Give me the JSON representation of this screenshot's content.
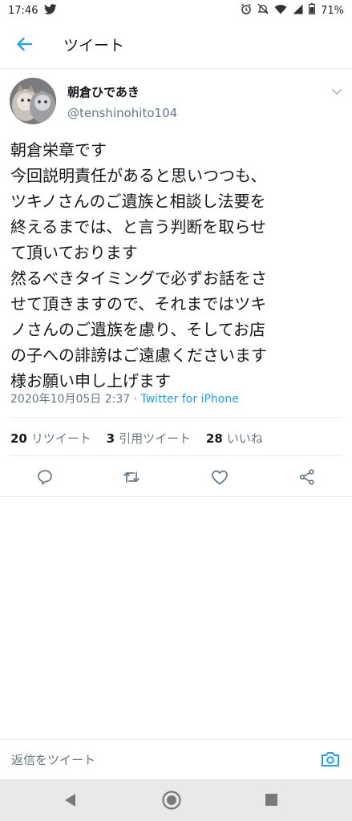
{
  "status_bar": {
    "time": "17:46",
    "battery": "71%",
    "icons": [
      "twitter-icon",
      "alarm-icon",
      "mute-icon",
      "wifi-icon",
      "signal-icon",
      "battery-icon"
    ]
  },
  "header": {
    "title": "ツイート",
    "back_icon": "back-arrow-icon"
  },
  "tweet": {
    "display_name": "朝倉ひであき",
    "handle": "@tenshinohito104",
    "lines": [
      "朝倉栄章です",
      "今回説明責任があると思いつつも、",
      "ツキノさんのご遺族と相談し法要を",
      "終えるまでは、と言う判断を取らせ",
      "て頂いております",
      "然るべきタイミングで必ずお話をさ",
      "せて頂きますので、それまではツキ",
      "ノさんのご遺族を慮り、そしてお店",
      "の子への誹謗はご遠慮くださいます",
      "様お願い申し上げます"
    ],
    "timestamp": "2020年10月05日 2:37 · ",
    "source": "Twitter for iPhone"
  },
  "stats": {
    "retweets_count": "20",
    "retweets_label": "リツイート",
    "quotes_count": "3",
    "quotes_label": "引用ツイート",
    "likes_count": "28",
    "likes_label": "いいね"
  },
  "actions": [
    "reply-icon",
    "retweet-icon",
    "like-icon",
    "share-icon"
  ],
  "reply_bar": {
    "placeholder": "返信をツイート"
  },
  "colors": {
    "accent": "#1da1f2",
    "secondary_text": "#657786",
    "divider": "#e6ecf0",
    "nav_bar": "#e9e9e9"
  }
}
